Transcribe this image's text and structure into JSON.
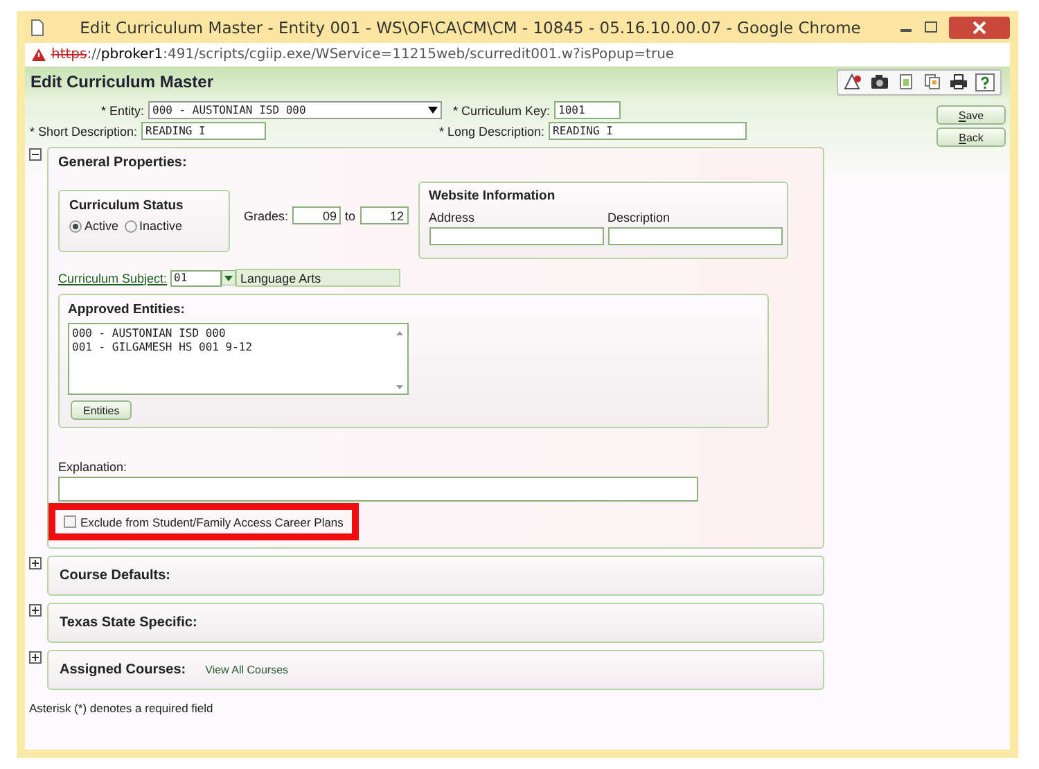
{
  "window": {
    "title": "Edit Curriculum Master - Entity 001 - WS\\OF\\CA\\CM\\CM - 10845 - 05.16.10.00.07 - Google Chrome"
  },
  "address_bar": {
    "scheme": "https",
    "separator": "://",
    "host": "pbroker1",
    "path": ":491/scripts/cgiip.exe/WService=11215web/scurredit001.w?isPopup=true"
  },
  "page_title": "Edit Curriculum Master",
  "header_fields": [
    {
      "label": "* Entity:",
      "value": "000 - AUSTONIAN ISD 000",
      "kind": "select"
    },
    {
      "label": "* Curriculum Key:",
      "value": "1001",
      "kind": "text"
    },
    {
      "label": "* Short Description:",
      "value": "READING I",
      "kind": "text"
    },
    {
      "label": "* Long Description:",
      "value": "READING I",
      "kind": "text"
    }
  ],
  "buttons": [
    "Save",
    "Back"
  ],
  "general": {
    "title": "General Properties:",
    "expanded": true,
    "status": {
      "title": "Curriculum Status",
      "options": [
        {
          "label": "Active",
          "selected": true
        },
        {
          "label": "Inactive",
          "selected": false
        }
      ]
    },
    "grades": {
      "label": "Grades:",
      "from": "09",
      "to_label": "to",
      "to": "12"
    },
    "website": {
      "title": "Website Information",
      "columns": [
        "Address",
        "Description"
      ]
    },
    "subject": {
      "label": "Curriculum Subject:",
      "code": "01",
      "name": "Language Arts"
    },
    "approved": {
      "title": "Approved Entities:",
      "items": [
        "000 - AUSTONIAN ISD 000",
        "001 - GILGAMESH HS 001 9-12"
      ],
      "button": "Entities"
    },
    "explanation": {
      "label": "Explanation:"
    },
    "exclude": {
      "label": "Exclude from Student/Family Access Career Plans",
      "checked": false,
      "highlighted": true
    }
  },
  "sections": [
    {
      "title": "Course Defaults:",
      "expanded": false
    },
    {
      "title": "Texas State Specific:",
      "expanded": false
    },
    {
      "title": "Assigned Courses:",
      "expanded": false,
      "link": "View All Courses"
    }
  ],
  "footnote": "Asterisk (*) denotes a required field"
}
